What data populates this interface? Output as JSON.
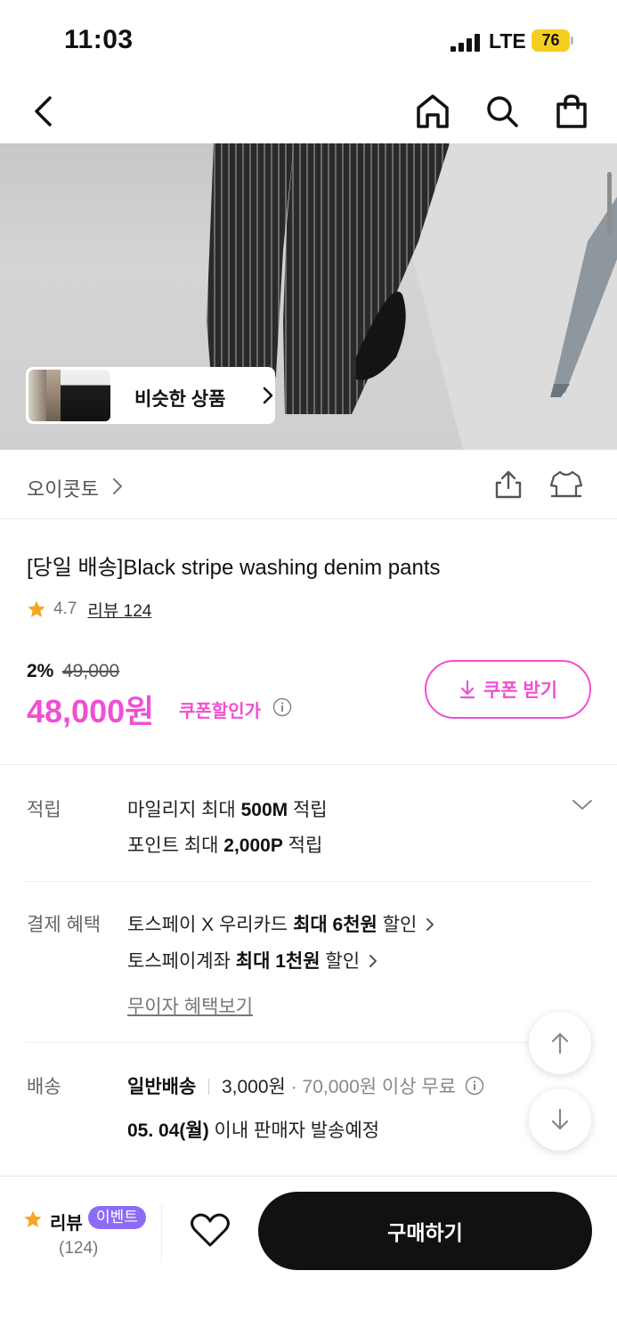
{
  "status_bar": {
    "time": "11:03",
    "network": "LTE",
    "battery": "76"
  },
  "nav": {
    "back_icon": "chevron-left-icon",
    "home_icon": "home-icon",
    "search_icon": "search-icon",
    "cart_icon": "shopping-bag-icon"
  },
  "hero": {
    "similar_label": "비슷한 상품"
  },
  "brand": {
    "name": "오이콧토"
  },
  "product": {
    "title": "[당일 배송]Black stripe washing denim pants",
    "rating": "4.7",
    "reviews_label": "리뷰 124"
  },
  "price": {
    "discount_rate": "2%",
    "original": "49,000",
    "sale": "48,000원",
    "coupon_price_label": "쿠폰할인가",
    "coupon_button": "쿠폰 받기"
  },
  "points": {
    "label": "적립",
    "line1_pre": "마일리지 최대 ",
    "line1_bold": "500M",
    "line1_post": " 적립",
    "line2_pre": "포인트 최대 ",
    "line2_bold": "2,000P",
    "line2_post": " 적립"
  },
  "payment": {
    "label": "결제 혜택",
    "line1_pre": "토스페이 X 우리카드 ",
    "line1_bold": "최대 6천원",
    "line1_post": " 할인",
    "line2_pre": "토스페이계좌 ",
    "line2_bold": "최대 1천원",
    "line2_post": " 할인",
    "installment_link": "무이자 혜택보기"
  },
  "shipping": {
    "label": "배송",
    "type": "일반배송",
    "fee": "3,000원",
    "free_threshold": "· 70,000원 이상 무료",
    "date_bold": "05. 04(월)",
    "date_post": " 이내 판매자 발송예정"
  },
  "bottom_bar": {
    "review_label": "리뷰",
    "event_badge": "이벤트",
    "review_count": "(124)",
    "buy_button": "구매하기"
  },
  "colors": {
    "accent": "#f04fd3",
    "event_badge": "#8c6cf5",
    "star": "#f5a623",
    "battery": "#f5cf1f"
  }
}
